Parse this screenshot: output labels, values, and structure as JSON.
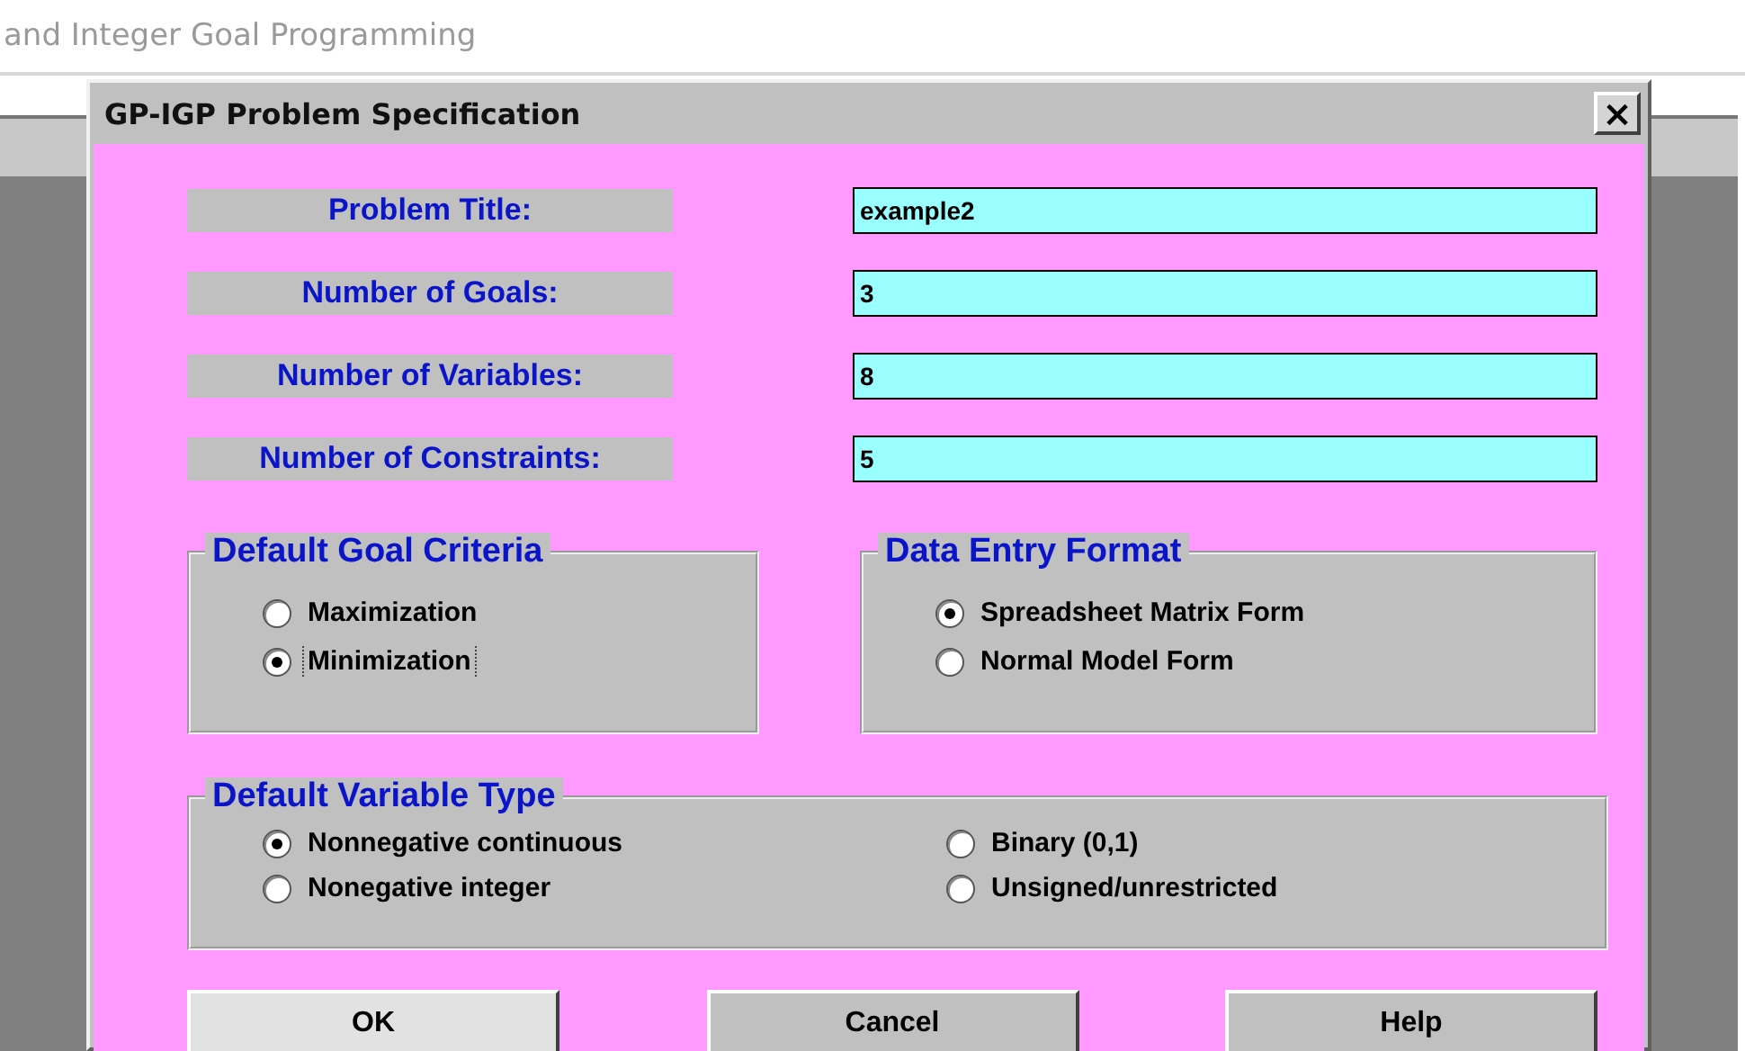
{
  "background": {
    "heading": "and Integer Goal Programming"
  },
  "window": {
    "title": "GP-IGP Problem Specification",
    "close": "×"
  },
  "fields": [
    {
      "label": "Problem Title:",
      "value": "example2"
    },
    {
      "label": "Number of Goals:",
      "value": "3"
    },
    {
      "label": "Number of Variables:",
      "value": "8"
    },
    {
      "label": "Number of Constraints:",
      "value": "5"
    }
  ],
  "goal_criteria": {
    "title": "Default Goal Criteria",
    "options": [
      {
        "label": "Maximization",
        "selected": false,
        "focused": false
      },
      {
        "label": "Minimization",
        "selected": true,
        "focused": true
      }
    ]
  },
  "data_entry_format": {
    "title": "Data Entry Format",
    "options": [
      {
        "label": "Spreadsheet Matrix Form",
        "selected": true
      },
      {
        "label": "Normal Model Form",
        "selected": false
      }
    ]
  },
  "variable_type": {
    "title": "Default Variable Type",
    "options": [
      {
        "label": "Nonnegative continuous",
        "selected": true
      },
      {
        "label": "Nonegative integer",
        "selected": false
      },
      {
        "label": "Binary (0,1)",
        "selected": false
      },
      {
        "label": "Unsigned/unrestricted",
        "selected": false
      }
    ]
  },
  "buttons": [
    {
      "label": "OK",
      "focused": true
    },
    {
      "label": "Cancel",
      "focused": false
    },
    {
      "label": "Help",
      "focused": false
    }
  ]
}
